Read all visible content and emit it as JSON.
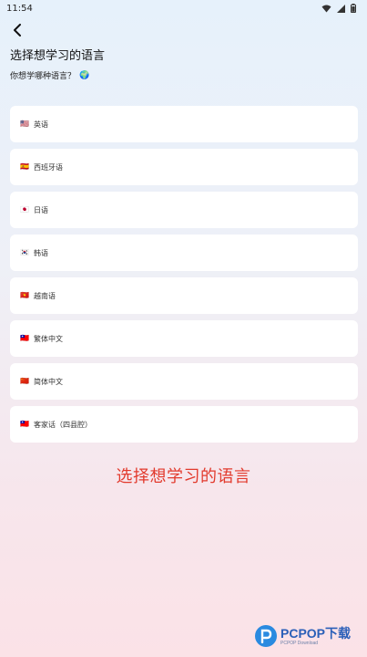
{
  "status": {
    "time": "11:54"
  },
  "header": {
    "title": "选择想学习的语言",
    "subtitle": "你想学哪种语言？",
    "subtitle_emoji": "🌍"
  },
  "languages": [
    {
      "flag": "🇺🇸",
      "label": "英语"
    },
    {
      "flag": "🇪🇸",
      "label": "西班牙语"
    },
    {
      "flag": "🇯🇵",
      "label": "日语"
    },
    {
      "flag": "🇰🇷",
      "label": "韩语"
    },
    {
      "flag": "🇻🇳",
      "label": "越南语"
    },
    {
      "flag": "🇹🇼",
      "label": "繁体中文"
    },
    {
      "flag": "🇨🇳",
      "label": "简体中文"
    },
    {
      "flag": "🇹🇼",
      "label": "客家话（四县腔）"
    }
  ],
  "banner": {
    "text": "选择想学习的语言"
  },
  "watermark": {
    "main": "PCPOP下载",
    "sub": "PCPOP Download"
  },
  "colors": {
    "accent_red": "#e23a2d",
    "watermark_blue": "#2a5fb8"
  }
}
